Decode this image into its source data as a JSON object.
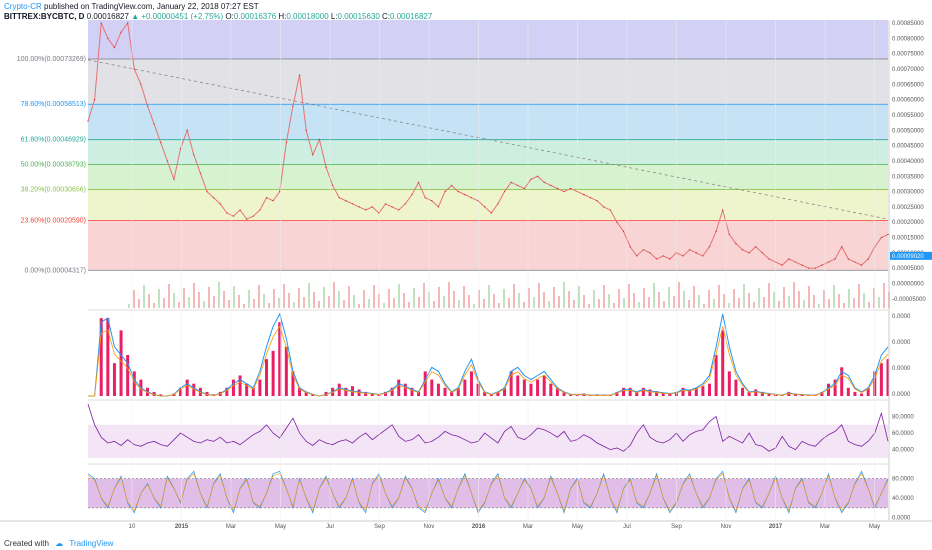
{
  "header": {
    "author": "Crypto-CR",
    "published": "published on TradingView.com, January 22, 2018 07:27 EST",
    "symbol": "BITTREX:BYCBTC, D",
    "last": "0.00016827",
    "change": "+0.00000451 (+2.75%)",
    "o_label": "O:",
    "o_value": "0.00016376",
    "h_label": "H:",
    "h_value": "0.00018000",
    "l_label": "L:",
    "l_value": "0.00015630",
    "c_label": "C:",
    "c_value": "0.00016827"
  },
  "footer": {
    "created_with": "Created with",
    "brand": "TradingView"
  },
  "chart_data": [
    {
      "type": "line",
      "panel": "price",
      "title": "BITTREX:BYCBTC, D",
      "x_ticks": [
        "10",
        "2015",
        "Mar",
        "May",
        "Jul",
        "Sep",
        "Nov",
        "2016",
        "Mar",
        "May",
        "Jul",
        "Sep",
        "Nov",
        "2017",
        "Mar",
        "May"
      ],
      "y_ticks": [
        "0.00085000",
        "0.00080000",
        "0.00075000",
        "0.00070000",
        "0.00065000",
        "0.00060000",
        "0.00055000",
        "0.00050000",
        "0.00045000",
        "0.00040000",
        "0.00035000",
        "0.00030000",
        "0.00025000",
        "0.00020000",
        "0.00015000",
        "0.00010000",
        "0.00005000",
        "0.00000000",
        "-0.00005000"
      ],
      "ylim": [
        -8e-05,
        0.00086
      ],
      "last_price_label": "0.00009020",
      "fib_levels": [
        {
          "label": "100.00%(0.00073269)",
          "value": 0.00073269,
          "color": "#787b86",
          "fill": "#e1e1e6"
        },
        {
          "label": "78.60%(0.00058513)",
          "value": 0.00058513,
          "color": "#2196f3",
          "fill": "#c6e2f5"
        },
        {
          "label": "61.80%(0.00046929)",
          "value": 0.00046929,
          "color": "#26a69a",
          "fill": "#cdeee0"
        },
        {
          "label": "50.00%(0.00038793)",
          "value": 0.00038793,
          "color": "#4caf50",
          "fill": "#d7f2cf"
        },
        {
          "label": "38.20%(0.00030656)",
          "value": 0.00030656,
          "color": "#8bc34a",
          "fill": "#eef5cc"
        },
        {
          "label": "23.60%(0.00020590)",
          "value": 0.0002059,
          "color": "#f44336",
          "fill": "#f8d4d4"
        },
        {
          "label": "0.00%(0.00004317)",
          "value": 4.317e-05,
          "color": "#787b86",
          "fill": ""
        }
      ],
      "fib_top_fill": "#d2d0f5",
      "price_series": [
        [
          0,
          0.00053
        ],
        [
          1,
          0.0006
        ],
        [
          2,
          0.00085
        ],
        [
          3,
          0.0008
        ],
        [
          4,
          0.00077
        ],
        [
          5,
          0.00082
        ],
        [
          6,
          0.00085
        ],
        [
          7,
          0.0007
        ],
        [
          8,
          0.00065
        ],
        [
          9,
          0.00058
        ],
        [
          10,
          0.00052
        ],
        [
          11,
          0.00046
        ],
        [
          12,
          0.0004
        ],
        [
          13,
          0.00034
        ],
        [
          14,
          0.00044
        ],
        [
          15,
          0.0005
        ],
        [
          16,
          0.00042
        ],
        [
          17,
          0.00036
        ],
        [
          18,
          0.0003
        ],
        [
          19,
          0.00028
        ],
        [
          20,
          0.00026
        ],
        [
          21,
          0.00023
        ],
        [
          22,
          0.00022
        ],
        [
          23,
          0.00024
        ],
        [
          24,
          0.00021
        ],
        [
          25,
          0.00022
        ],
        [
          26,
          0.00024
        ],
        [
          27,
          0.00028
        ],
        [
          28,
          0.00027
        ],
        [
          29,
          0.0003
        ],
        [
          30,
          0.00046
        ],
        [
          31,
          0.00058
        ],
        [
          32,
          0.00068
        ],
        [
          33,
          0.0005
        ],
        [
          34,
          0.00042
        ],
        [
          35,
          0.00047
        ],
        [
          36,
          0.00038
        ],
        [
          37,
          0.00032
        ],
        [
          38,
          0.00028
        ],
        [
          39,
          0.00027
        ],
        [
          40,
          0.00026
        ],
        [
          41,
          0.00025
        ],
        [
          42,
          0.00024
        ],
        [
          43,
          0.00025
        ],
        [
          44,
          0.00023
        ],
        [
          45,
          0.00026
        ],
        [
          46,
          0.00025
        ],
        [
          47,
          0.00024
        ],
        [
          48,
          0.00026
        ],
        [
          49,
          0.00029
        ],
        [
          50,
          0.00033
        ],
        [
          51,
          0.00028
        ],
        [
          52,
          0.00027
        ],
        [
          53,
          0.00025
        ],
        [
          54,
          0.0003
        ],
        [
          55,
          0.00032
        ],
        [
          56,
          0.0003
        ],
        [
          57,
          0.00029
        ],
        [
          58,
          0.00028
        ],
        [
          59,
          0.00027
        ],
        [
          60,
          0.00025
        ],
        [
          61,
          0.00023
        ],
        [
          62,
          0.00026
        ],
        [
          63,
          0.0003
        ],
        [
          64,
          0.00033
        ],
        [
          65,
          0.00032
        ],
        [
          66,
          0.00031
        ],
        [
          67,
          0.00034
        ],
        [
          68,
          0.00035
        ],
        [
          69,
          0.00033
        ],
        [
          70,
          0.00032
        ],
        [
          71,
          0.00031
        ],
        [
          72,
          0.0003
        ],
        [
          73,
          0.00031
        ],
        [
          74,
          0.0003
        ],
        [
          75,
          0.00029
        ],
        [
          76,
          0.00028
        ],
        [
          77,
          0.00027
        ],
        [
          78,
          0.00025
        ],
        [
          79,
          0.00024
        ],
        [
          80,
          0.0002
        ],
        [
          81,
          0.00017
        ],
        [
          82,
          0.00012
        ],
        [
          83,
          9e-05
        ],
        [
          84,
          0.00011
        ],
        [
          85,
          0.0001
        ],
        [
          86,
          8e-05
        ],
        [
          87,
          9e-05
        ],
        [
          88,
          8e-05
        ],
        [
          89,
          0.0001
        ],
        [
          90,
          9e-05
        ],
        [
          91,
          0.00011
        ],
        [
          92,
          0.0001
        ],
        [
          93,
          9e-05
        ],
        [
          94,
          0.00012
        ],
        [
          95,
          0.00017
        ],
        [
          96,
          0.00024
        ],
        [
          97,
          0.00016
        ],
        [
          98,
          0.00013
        ],
        [
          99,
          0.00011
        ],
        [
          100,
          0.0001
        ],
        [
          101,
          0.00012
        ],
        [
          102,
          0.0001
        ],
        [
          103,
          8e-05
        ],
        [
          104,
          7e-05
        ],
        [
          105,
          6e-05
        ],
        [
          106,
          8e-05
        ],
        [
          107,
          7e-05
        ],
        [
          108,
          6e-05
        ],
        [
          109,
          5e-05
        ],
        [
          110,
          5e-05
        ],
        [
          111,
          6e-05
        ],
        [
          112,
          7e-05
        ],
        [
          113,
          8e-05
        ],
        [
          114,
          0.00012
        ],
        [
          115,
          8e-05
        ],
        [
          116,
          7e-05
        ],
        [
          117,
          6e-05
        ],
        [
          118,
          8e-05
        ],
        [
          119,
          0.00012
        ],
        [
          120,
          0.00015
        ],
        [
          121,
          0.00016
        ]
      ],
      "price_x_max": 121,
      "line_color": "#e57373",
      "trend_line": [
        [
          0,
          0.00073
        ],
        [
          121,
          0.00021
        ]
      ]
    },
    {
      "type": "bar",
      "panel": "macd",
      "y_ticks": [
        "0.0000",
        "0.0000",
        "0.0000",
        "0.0000"
      ],
      "histogram_color": "#e91e63",
      "line1_color": "#2196f3",
      "line2_color": "#ff9800",
      "hist": [
        0,
        0,
        0.95,
        0.95,
        0.4,
        0.8,
        0.5,
        0.3,
        0.2,
        0.1,
        0.05,
        0.02,
        0,
        0.03,
        0.1,
        0.2,
        0.15,
        0.1,
        0.05,
        0.02,
        0.05,
        0.1,
        0.2,
        0.25,
        0.15,
        0.1,
        0.2,
        0.45,
        0.55,
        0.9,
        0.6,
        0.3,
        0.1,
        0.05,
        0.02,
        0,
        0.05,
        0.1,
        0.15,
        0.1,
        0.12,
        0.08,
        0.05,
        0.03,
        0.02,
        0.05,
        0.1,
        0.2,
        0.15,
        0.1,
        0.05,
        0.3,
        0.2,
        0.15,
        0.1,
        0.05,
        0.1,
        0.2,
        0.3,
        0.15,
        0.05,
        0.02,
        0.05,
        0.1,
        0.3,
        0.25,
        0.2,
        0.15,
        0.2,
        0.25,
        0.15,
        0.1,
        0.05,
        0.02,
        0.02,
        0.03,
        0.01,
        0.02,
        0.01,
        0.01,
        0.05,
        0.1,
        0.1,
        0.05,
        0.1,
        0.08,
        0.06,
        0.04,
        0.03,
        0.05,
        0.1,
        0.08,
        0.1,
        0.12,
        0.15,
        0.5,
        0.8,
        0.3,
        0.2,
        0.1,
        0.05,
        0.08,
        0.05,
        0.03,
        0.02,
        0.01,
        0.05,
        0.03,
        0.02,
        0.01,
        0.01,
        0.05,
        0.15,
        0.2,
        0.35,
        0.1,
        0.05,
        0.03,
        0.1,
        0.3,
        0.4,
        0.45
      ],
      "line1": [
        0,
        0,
        0.9,
        0.95,
        0.6,
        0.5,
        0.4,
        0.2,
        0.1,
        0.05,
        0.02,
        0,
        0,
        0.02,
        0.1,
        0.15,
        0.1,
        0.05,
        0.02,
        0.01,
        0.03,
        0.08,
        0.15,
        0.2,
        0.15,
        0.1,
        0.3,
        0.6,
        0.85,
        1,
        0.7,
        0.3,
        0.1,
        0.05,
        0.02,
        0,
        0.02,
        0.05,
        0.1,
        0.08,
        0.06,
        0.05,
        0.04,
        0.03,
        0.02,
        0.04,
        0.08,
        0.15,
        0.12,
        0.08,
        0.05,
        0.2,
        0.35,
        0.3,
        0.15,
        0.05,
        0.1,
        0.3,
        0.45,
        0.2,
        0.05,
        0.02,
        0.05,
        0.1,
        0.3,
        0.35,
        0.25,
        0.2,
        0.25,
        0.3,
        0.2,
        0.1,
        0.05,
        0.02,
        0.02,
        0.02,
        0.01,
        0.01,
        0.01,
        0.01,
        0.04,
        0.08,
        0.08,
        0.05,
        0.08,
        0.06,
        0.05,
        0.04,
        0.03,
        0.04,
        0.08,
        0.07,
        0.1,
        0.15,
        0.25,
        0.6,
        1,
        0.6,
        0.3,
        0.15,
        0.05,
        0.06,
        0.04,
        0.03,
        0.02,
        0.01,
        0.04,
        0.02,
        0.02,
        0.01,
        0.01,
        0.04,
        0.1,
        0.15,
        0.3,
        0.25,
        0.1,
        0.05,
        0.1,
        0.25,
        0.5,
        0.6
      ]
    },
    {
      "type": "line",
      "panel": "rsi",
      "y_ticks": [
        "80.0000",
        "60.0000",
        "40.0000"
      ],
      "ylim": [
        25,
        100
      ],
      "band": [
        30,
        70
      ],
      "line_color": "#7b1fa2",
      "values": [
        95,
        70,
        55,
        48,
        50,
        45,
        52,
        46,
        44,
        48,
        50,
        46,
        44,
        52,
        60,
        55,
        50,
        48,
        52,
        50,
        55,
        48,
        50,
        46,
        52,
        58,
        62,
        70,
        60,
        54,
        66,
        78,
        60,
        50,
        45,
        52,
        48,
        46,
        50,
        52,
        48,
        55,
        60,
        52,
        58,
        64,
        70,
        56,
        50,
        52,
        58,
        48,
        50,
        55,
        62,
        58,
        56,
        52,
        48,
        50,
        60,
        54,
        48,
        62,
        68,
        55,
        52,
        58,
        66,
        64,
        60,
        55,
        62,
        50,
        52,
        58,
        54,
        48,
        44,
        40,
        42,
        38,
        45,
        60,
        70,
        55,
        50,
        48,
        52,
        60,
        50,
        58,
        62,
        64,
        74,
        80,
        50,
        56,
        52,
        48,
        60,
        46,
        44,
        38,
        42,
        56,
        44,
        40,
        50,
        46,
        44,
        52,
        58,
        62,
        70,
        50,
        46,
        44,
        50,
        60,
        84,
        50
      ]
    },
    {
      "type": "line",
      "panel": "stoch",
      "y_ticks": [
        "80.0000",
        "40.0000",
        "0.0000"
      ],
      "ylim": [
        -5,
        110
      ],
      "band": [
        20,
        80
      ],
      "line1_color": "#2196f3",
      "line2_color": "#ff9800",
      "values": [
        90,
        80,
        40,
        20,
        60,
        85,
        30,
        10,
        50,
        70,
        40,
        20,
        85,
        60,
        30,
        80,
        95,
        50,
        20,
        70,
        90,
        40,
        10,
        60,
        80,
        30,
        20,
        50,
        90,
        95,
        60,
        20,
        80,
        40,
        10,
        60,
        85,
        50,
        20,
        40,
        80,
        30,
        10,
        70,
        90,
        50,
        20,
        40,
        85,
        60,
        20,
        10,
        50,
        80,
        40,
        20,
        60,
        90,
        50,
        10,
        30,
        70,
        90,
        40,
        20,
        50,
        80,
        60,
        20,
        40,
        85,
        50,
        10,
        60,
        80,
        30,
        20,
        50,
        90,
        40,
        10,
        60,
        80,
        30,
        20,
        50,
        90,
        40,
        10,
        30,
        70,
        90,
        50,
        20,
        40,
        80,
        95,
        40,
        10,
        60,
        80,
        30,
        20,
        50,
        85,
        40,
        10,
        60,
        80,
        30,
        20,
        50,
        90,
        40,
        10,
        30,
        70,
        95,
        60,
        20,
        50,
        80
      ]
    }
  ]
}
